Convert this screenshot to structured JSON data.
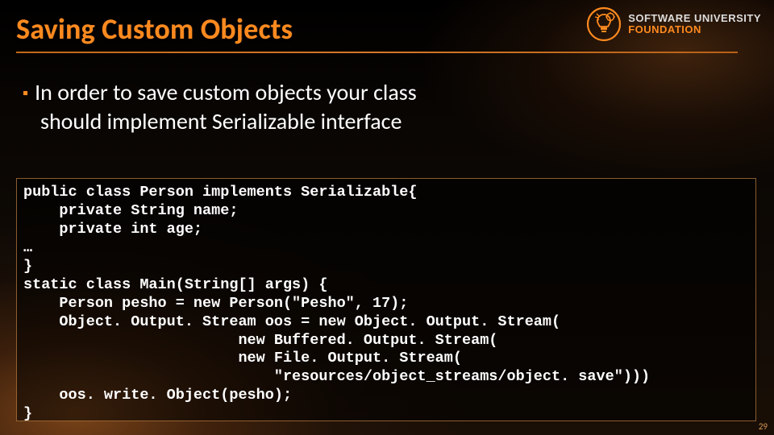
{
  "title": "Saving Custom Objects",
  "logo": {
    "line1": "SOFTWARE UNIVERSITY",
    "line2": "FOUNDATION"
  },
  "bullet": {
    "marker": "▪",
    "text": "In order to save custom objects your class should implement Serializable interface"
  },
  "code": "public class Person implements Serializable{\n    private String name;\n    private int age;\n…\n}\nstatic class Main(String[] args) {\n    Person pesho = new Person(\"Pesho\", 17);\n    Object. Output. Stream oos = new Object. Output. Stream(\n                        new Buffered. Output. Stream(\n                        new File. Output. Stream(\n                            \"resources/object_streams/object. save\")))\n    oos. write. Object(pesho);\n}",
  "page_number": "29"
}
